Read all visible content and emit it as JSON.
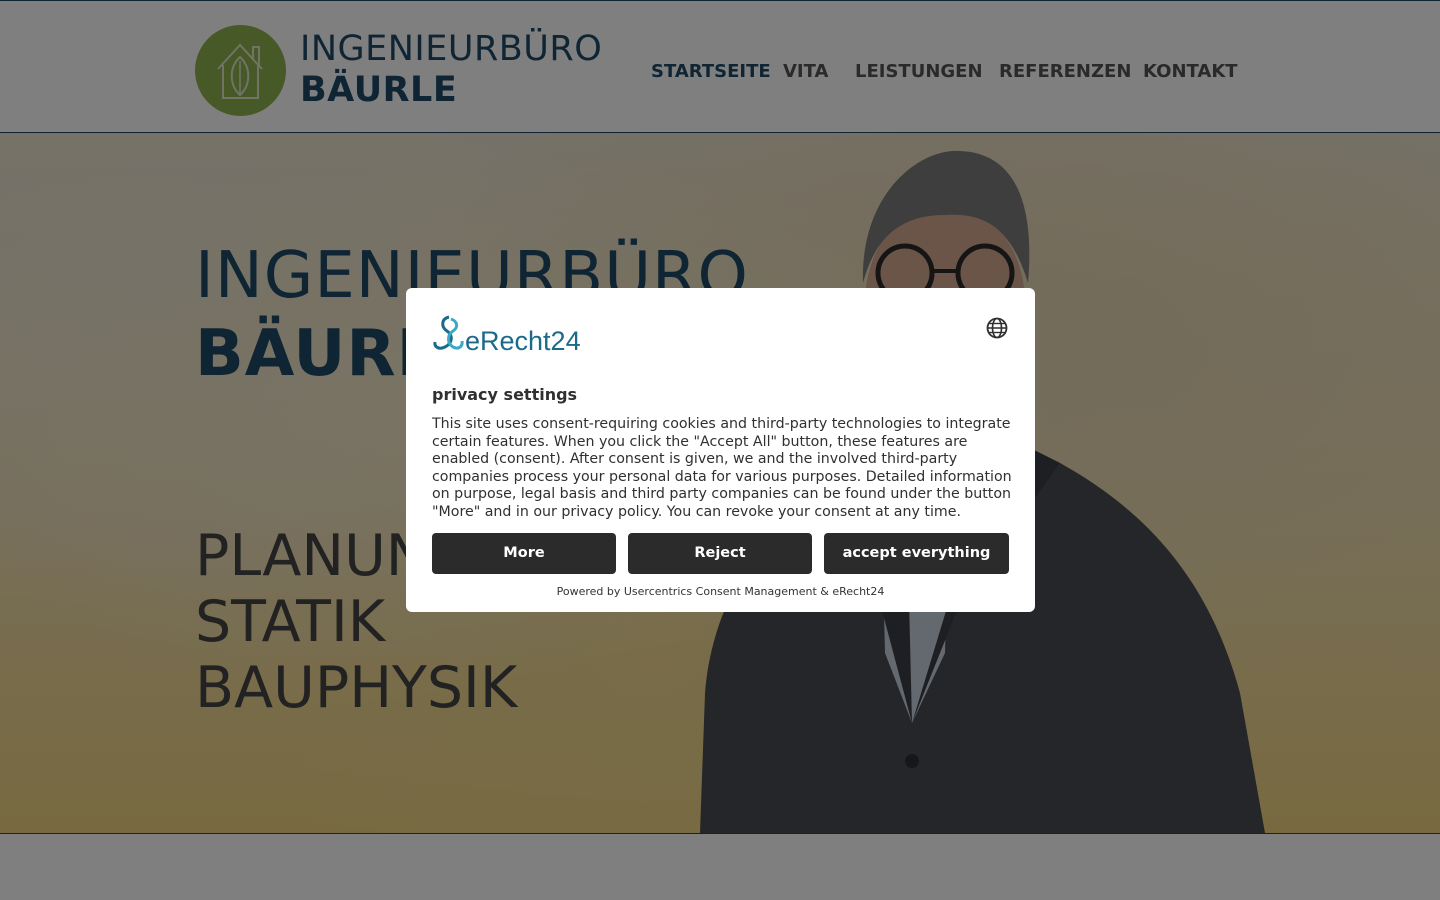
{
  "header": {
    "logo_icon": "house-leaf-icon",
    "brand_line1": "INGENIEURBÜRO",
    "brand_line2": "BÄURLE",
    "nav": [
      {
        "label": "STARTSEITE",
        "active": true
      },
      {
        "label": "VITA",
        "active": false
      },
      {
        "label": "LEISTUNGEN",
        "active": false
      },
      {
        "label": "REFERENZEN",
        "active": false
      },
      {
        "label": "KONTAKT",
        "active": false
      }
    ]
  },
  "hero": {
    "title_line1": "INGENIEURBÜRO",
    "title_line2": "BÄURLE",
    "services": [
      "PLANUNG",
      "STATIK",
      "BAUPHYSIK"
    ]
  },
  "consent": {
    "logo_text": "eRecht24",
    "language_icon": "globe-icon",
    "title": "privacy settings",
    "text": "This site uses consent-requiring cookies and third-party technologies to integrate certain features. When you click the \"Accept All\" button, these features are enabled (consent). After consent is given, we and the involved third-party companies process your personal data for various purposes. Detailed information on purpose, legal basis and third party companies can be found under the button \"More\" and in our privacy policy. You can revoke your consent at any time.",
    "buttons": {
      "more": "More",
      "reject": "Reject",
      "accept": "accept everything"
    },
    "powered_by": "Powered by Usercentrics Consent Management & eRecht24"
  },
  "colors": {
    "brand_blue": "#1f4a66",
    "logo_green": "#8db34d",
    "button_dark": "#2b2b2b",
    "erecht_blue": "#1b6a8a",
    "erecht_cyan": "#3aa9c8"
  }
}
